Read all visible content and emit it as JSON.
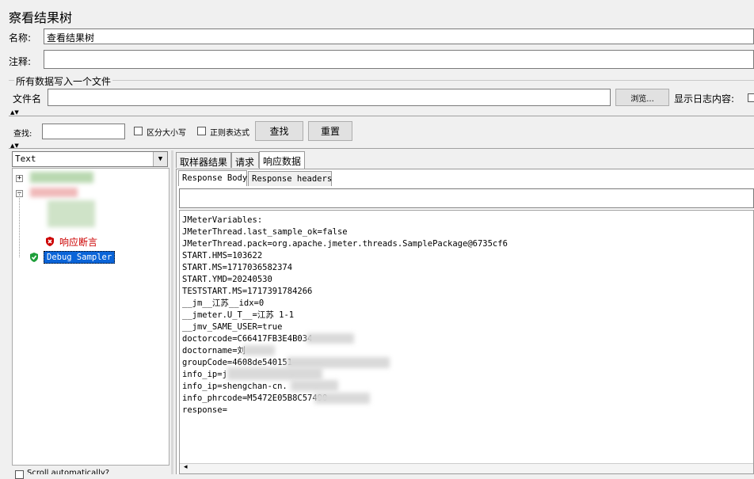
{
  "panel": {
    "title": "察看结果树",
    "name_label": "名称:",
    "name_value": "查看结果树",
    "comment_label": "注释:",
    "comment_value": ""
  },
  "file_section": {
    "legend": "所有数据写入一个文件",
    "filename_label": "文件名",
    "filename_value": "",
    "browse_label": "浏览...",
    "log_label": "显示日志内容:"
  },
  "search": {
    "label": "查找:",
    "value": "",
    "case_label": "区分大小写",
    "regex_label": "正则表达式",
    "find_button": "查找",
    "reset_button": "重置"
  },
  "renderer": {
    "selected": "Text"
  },
  "tree": {
    "assertion_label": "响应断言",
    "debug_label": "Debug Sampler",
    "bottom_checkbox_label": "Scroll automatically?"
  },
  "tabs": [
    {
      "label": "取样器结果"
    },
    {
      "label": "请求"
    },
    {
      "label": "响应数据"
    }
  ],
  "subtabs": [
    {
      "label": "Response Body"
    },
    {
      "label": "Response headers"
    }
  ],
  "response_lines": [
    "JMeterVariables:",
    "JMeterThread.last_sample_ok=false",
    "JMeterThread.pack=org.apache.jmeter.threads.SamplePackage@6735cf6",
    "START.HMS=103622",
    "START.MS=1717036582374",
    "START.YMD=20240530",
    "TESTSTART.MS=1717391784266",
    "__jm__江苏__idx=0",
    "__jmeter.U_T__=江苏 1-1",
    "__jmv_SAME_USER=true",
    "doctorcode=C66417FB3E4B034",
    "doctorname=刘",
    "groupCode=4608de540151",
    "info_ip=j",
    "info_ip=shengchan-cn.",
    "info_phrcode=M5472E05B8C57490",
    "response="
  ],
  "colors": {
    "selection": "#0a64d8",
    "assertion_error": "#cc0000",
    "success": "#1e9e3a"
  }
}
